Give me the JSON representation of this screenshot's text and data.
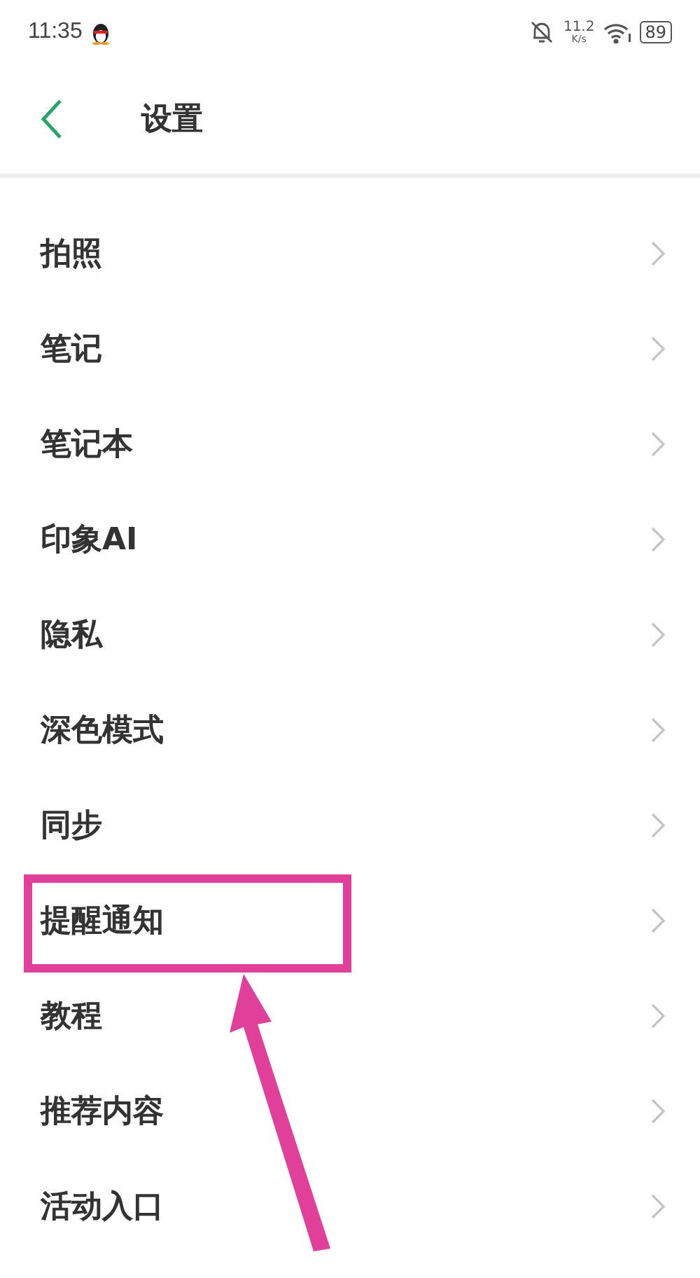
{
  "status_bar": {
    "time": "11:35",
    "speed": "11.2",
    "speed_unit": "K/s",
    "battery": "89"
  },
  "header": {
    "title": "设置"
  },
  "items": [
    {
      "label": "拍照",
      "annotated": false
    },
    {
      "label": "笔记",
      "annotated": false
    },
    {
      "label": "笔记本",
      "annotated": false
    },
    {
      "label": "印象AI",
      "annotated": false
    },
    {
      "label": "隐私",
      "annotated": false
    },
    {
      "label": "深色模式",
      "annotated": false
    },
    {
      "label": "同步",
      "annotated": false
    },
    {
      "label": "提醒通知",
      "annotated": true
    },
    {
      "label": "教程",
      "annotated": false
    },
    {
      "label": "推荐内容",
      "annotated": false
    },
    {
      "label": "活动入口",
      "annotated": false
    }
  ]
}
